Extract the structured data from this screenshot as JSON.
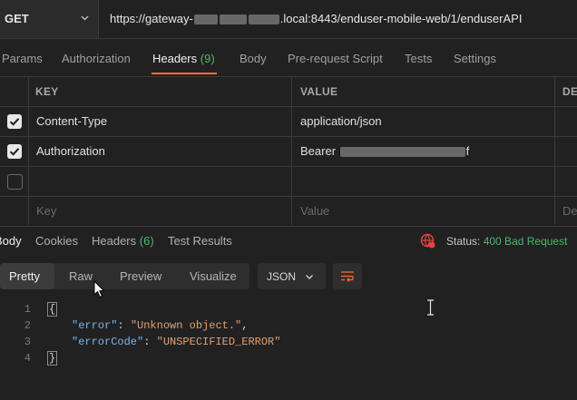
{
  "request": {
    "method": "GET",
    "url_prefix": "https://gateway-",
    "url_suffix": ".local:8443/enduser-mobile-web/1/enduserAPI"
  },
  "request_tabs": [
    {
      "label": "Params"
    },
    {
      "label": "Authorization"
    },
    {
      "label": "Headers",
      "count": "(9)",
      "active": true
    },
    {
      "label": "Body"
    },
    {
      "label": "Pre-request Script"
    },
    {
      "label": "Tests"
    },
    {
      "label": "Settings"
    }
  ],
  "headers_table": {
    "columns": [
      "KEY",
      "VALUE",
      "DE"
    ],
    "rows": [
      {
        "checked": true,
        "key": "Content-Type",
        "value": "application/json"
      },
      {
        "checked": true,
        "key": "Authorization",
        "value_prefix": "Bearer ",
        "value_suffix": "f"
      },
      {
        "checked": false,
        "key": "",
        "value": ""
      }
    ],
    "placeholder": {
      "key": "Key",
      "value": "Value",
      "desc": "De"
    }
  },
  "response_tabs": [
    {
      "label": "Body",
      "active": true
    },
    {
      "label": "Cookies"
    },
    {
      "label": "Headers",
      "count": "(6)"
    },
    {
      "label": "Test Results"
    }
  ],
  "status": {
    "label": "Status:",
    "value": "400 Bad Request",
    "icon": "globe-error-icon"
  },
  "format_tabs": [
    "Pretty",
    "Raw",
    "Preview",
    "Visualize"
  ],
  "language": "JSON",
  "code": {
    "line_numbers": [
      "1",
      "2",
      "3",
      "4"
    ],
    "open_brace": "{",
    "close_brace": "}",
    "key1": "\"error\"",
    "val1": "\"Unknown object.\"",
    "key2": "\"errorCode\"",
    "val2": "\"UNSPECIFIED_ERROR\""
  },
  "colors": {
    "accent": "#ff6c37",
    "success": "#49b96c",
    "error": "#e2453c"
  }
}
